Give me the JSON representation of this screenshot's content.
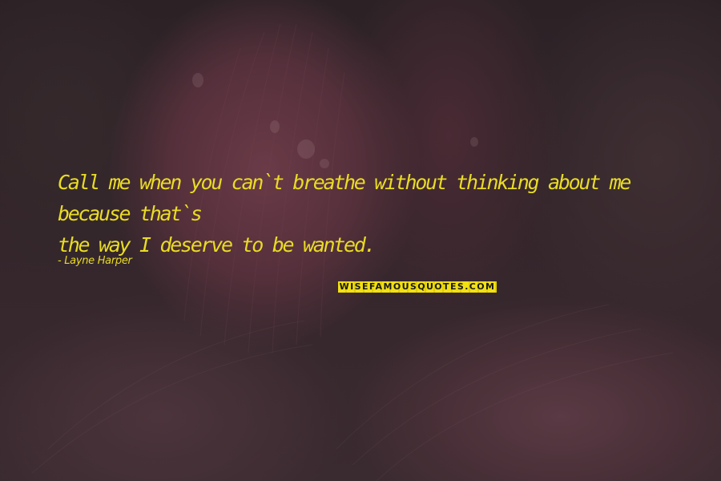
{
  "quote": {
    "line1": "Call me when you can`t breathe without thinking about me because that`s",
    "line2": "the way I deserve to be wanted."
  },
  "author": "Layne Harper",
  "watermark": "WISEFAMOUSQUOTES.COM",
  "colors": {
    "quote_text": "#e9dc24",
    "logo_background": "#f2e013",
    "background_dark": "#2a1f23"
  }
}
